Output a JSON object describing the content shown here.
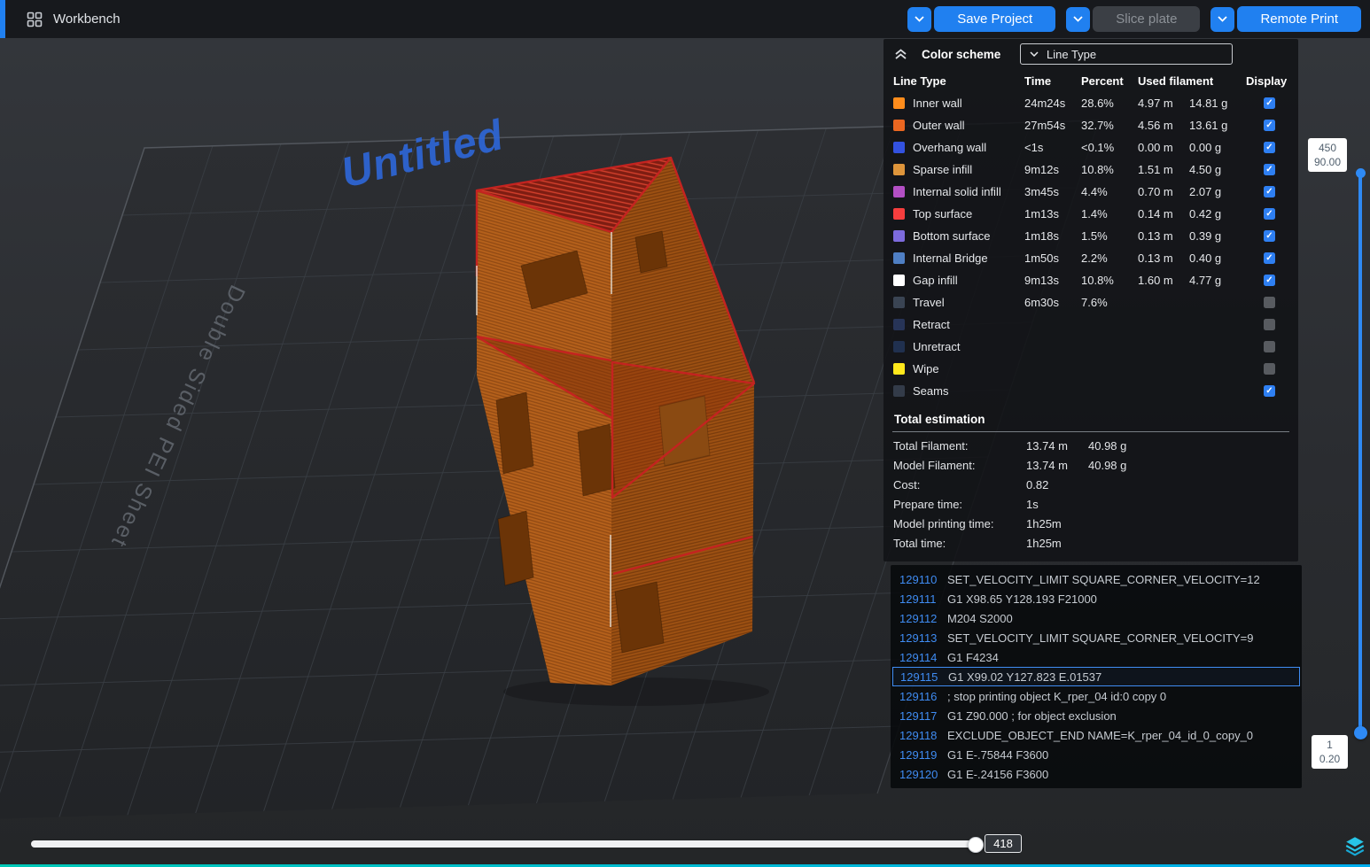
{
  "colors": {
    "accent_blue": "#2080F0",
    "bottom_bar_teal": "#00BCD4"
  },
  "icons": {
    "workbench": "grid-icon",
    "button_dropdowns": "chevron-down-icon",
    "panel_collapse": "chevron-double-up-icon",
    "scheme_dropdown": "chevron-down-icon",
    "display_checkbox": "check",
    "bottom_corner": "layers-icon"
  },
  "topbar": {
    "workbench_label": "Workbench",
    "save_project_label": "Save Project",
    "slice_plate_label": "Slice plate",
    "remote_print_label": "Remote Print"
  },
  "viewport": {
    "plate_name": "Untitled",
    "plate_surface_text": "Double Sided PEI Sheet"
  },
  "color_scheme": {
    "title": "Color scheme",
    "dropdown_value": "Line Type",
    "check_glyph": "✓",
    "columns": {
      "line_type": "Line Type",
      "time": "Time",
      "percent": "Percent",
      "used_filament": "Used filament",
      "display": "Display"
    },
    "rows": [
      {
        "label": "Inner wall",
        "color": "#FF8D1C",
        "time": "24m24s",
        "percent": "28.6%",
        "meters": "4.97 m",
        "grams": "14.81 g",
        "checked": true
      },
      {
        "label": "Outer wall",
        "color": "#EB6721",
        "time": "27m54s",
        "percent": "32.7%",
        "meters": "4.56 m",
        "grams": "13.61 g",
        "checked": true
      },
      {
        "label": "Overhang wall",
        "color": "#3352E0",
        "time": "<1s",
        "percent": "<0.1%",
        "meters": "0.00 m",
        "grams": "0.00 g",
        "checked": true
      },
      {
        "label": "Sparse infill",
        "color": "#DE953B",
        "time": "9m12s",
        "percent": "10.8%",
        "meters": "1.51 m",
        "grams": "4.50 g",
        "checked": true
      },
      {
        "label": "Internal solid infill",
        "color": "#B34FC4",
        "time": "3m45s",
        "percent": "4.4%",
        "meters": "0.70 m",
        "grams": "2.07 g",
        "checked": true
      },
      {
        "label": "Top surface",
        "color": "#F63E3E",
        "time": "1m13s",
        "percent": "1.4%",
        "meters": "0.14 m",
        "grams": "0.42 g",
        "checked": true
      },
      {
        "label": "Bottom surface",
        "color": "#7D6BDD",
        "time": "1m18s",
        "percent": "1.5%",
        "meters": "0.13 m",
        "grams": "0.39 g",
        "checked": true
      },
      {
        "label": "Internal Bridge",
        "color": "#4F7FC4",
        "time": "1m50s",
        "percent": "2.2%",
        "meters": "0.13 m",
        "grams": "0.40 g",
        "checked": true
      },
      {
        "label": "Gap infill",
        "color": "#FFFFFF",
        "time": "9m13s",
        "percent": "10.8%",
        "meters": "1.60 m",
        "grams": "4.77 g",
        "checked": true
      },
      {
        "label": "Travel",
        "color": "#3A4453",
        "time": "6m30s",
        "percent": "7.6%",
        "meters": "",
        "grams": "",
        "checked": false
      },
      {
        "label": "Retract",
        "color": "#273457",
        "time": "",
        "percent": "",
        "meters": "",
        "grams": "",
        "checked": false
      },
      {
        "label": "Unretract",
        "color": "#20304F",
        "time": "",
        "percent": "",
        "meters": "",
        "grams": "",
        "checked": false
      },
      {
        "label": "Wipe",
        "color": "#FFE81C",
        "time": "",
        "percent": "",
        "meters": "",
        "grams": "",
        "checked": false
      },
      {
        "label": "Seams",
        "color": "#333B49",
        "time": "",
        "percent": "",
        "meters": "",
        "grams": "",
        "checked": true
      }
    ]
  },
  "total_estimation": {
    "title": "Total estimation",
    "rows": [
      {
        "label": "Total Filament:",
        "v1": "13.74 m",
        "v2": "40.98 g"
      },
      {
        "label": "Model Filament:",
        "v1": "13.74 m",
        "v2": "40.98 g"
      },
      {
        "label": "Cost:",
        "v1": "0.82",
        "v2": ""
      },
      {
        "label": "Prepare time:",
        "v1": "1s",
        "v2": ""
      },
      {
        "label": "Model printing time:",
        "v1": "1h25m",
        "v2": ""
      },
      {
        "label": "Total time:",
        "v1": "1h25m",
        "v2": ""
      }
    ]
  },
  "gcode": {
    "lines": [
      {
        "num": "129110",
        "text": "SET_VELOCITY_LIMIT SQUARE_CORNER_VELOCITY=12",
        "highlight": false
      },
      {
        "num": "129111",
        "text": "G1 X98.65 Y128.193 F21000",
        "highlight": false
      },
      {
        "num": "129112",
        "text": "M204 S2000",
        "highlight": false
      },
      {
        "num": "129113",
        "text": "SET_VELOCITY_LIMIT SQUARE_CORNER_VELOCITY=9",
        "highlight": false
      },
      {
        "num": "129114",
        "text": "G1 F4234",
        "highlight": false
      },
      {
        "num": "129115",
        "text": "G1 X99.02 Y127.823 E.01537",
        "highlight": true
      },
      {
        "num": "129116",
        "text": "; stop printing object K_rper_04 id:0 copy 0",
        "highlight": false
      },
      {
        "num": "129117",
        "text": "G1 Z90.000 ; for object exclusion",
        "highlight": false
      },
      {
        "num": "129118",
        "text": "EXCLUDE_OBJECT_END NAME=K_rper_04_id_0_copy_0",
        "highlight": false
      },
      {
        "num": "129119",
        "text": "G1 E-.75844 F3600",
        "highlight": false
      },
      {
        "num": "129120",
        "text": "G1 E-.24156 F3600",
        "highlight": false
      }
    ]
  },
  "layer_slider": {
    "max_layer": "450",
    "max_height": "90.00",
    "min_layer": "1",
    "min_height": "0.20"
  },
  "move_slider": {
    "value": "418"
  }
}
